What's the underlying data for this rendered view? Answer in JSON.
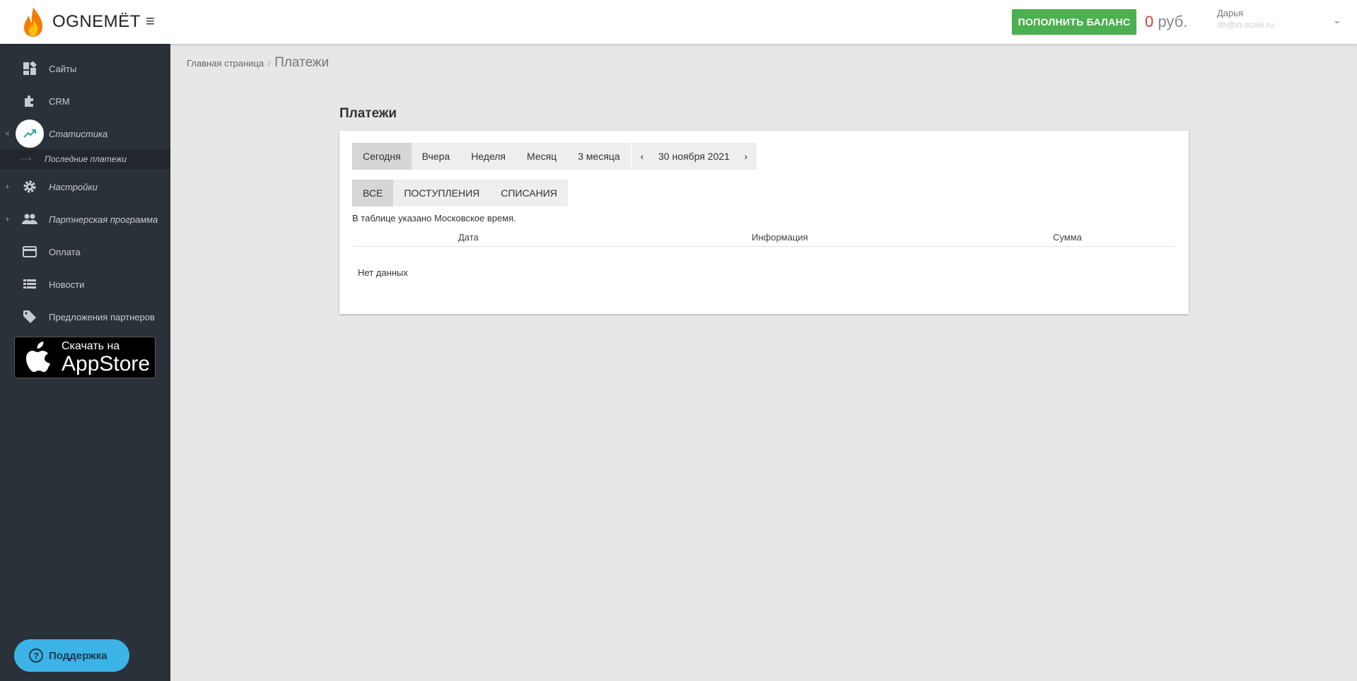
{
  "header": {
    "brand": "OGNEMЁT",
    "topup_label": "ПОПОЛНИТЬ БАЛАНС",
    "balance_amount": "0",
    "balance_currency": "руб.",
    "user_name": "Дарья",
    "user_email": "dh@in-scale.ru"
  },
  "sidebar": {
    "items": [
      {
        "label": "Сайты",
        "icon": "dashboard-icon"
      },
      {
        "label": "CRM",
        "icon": "puzzle-icon"
      },
      {
        "label": "Статистика",
        "icon": "trending-up-icon",
        "mark": "×"
      },
      {
        "label": "Настройки",
        "icon": "gear-icon",
        "mark": "+"
      },
      {
        "label": "Партнерская программа",
        "icon": "people-icon",
        "mark": "+"
      },
      {
        "label": "Оплата",
        "icon": "credit-card-icon"
      },
      {
        "label": "Новости",
        "icon": "list-icon"
      },
      {
        "label": "Предложения партнеров",
        "icon": "tag-icon"
      }
    ],
    "subitem": {
      "label": "Последние платежи",
      "mark": "---×"
    },
    "appstore": {
      "line1": "Скачать на",
      "line2": "AppStore"
    },
    "support_label": "Поддержка"
  },
  "breadcrumb": {
    "home": "Главная страница",
    "separator": "/",
    "current": "Платежи"
  },
  "main": {
    "title": "Платежи",
    "periods": [
      "Сегодня",
      "Вчера",
      "Неделя",
      "Месяц",
      "3 месяца"
    ],
    "active_period": "Сегодня",
    "date": "30 ноября 2021",
    "types": [
      "ВСЕ",
      "ПОСТУПЛЕНИЯ",
      "СПИСАНИЯ"
    ],
    "active_type": "ВСЕ",
    "note": "В таблице указано Московское время.",
    "columns": [
      "Дата",
      "Информация",
      "Сумма"
    ],
    "empty_text": "Нет данных"
  },
  "colors": {
    "sidebar_bg": "#2b3138",
    "accent_green": "#4caf50",
    "balance_red": "#e53935",
    "support_blue": "#3cb3e6",
    "page_bg": "#e6e7e6"
  }
}
